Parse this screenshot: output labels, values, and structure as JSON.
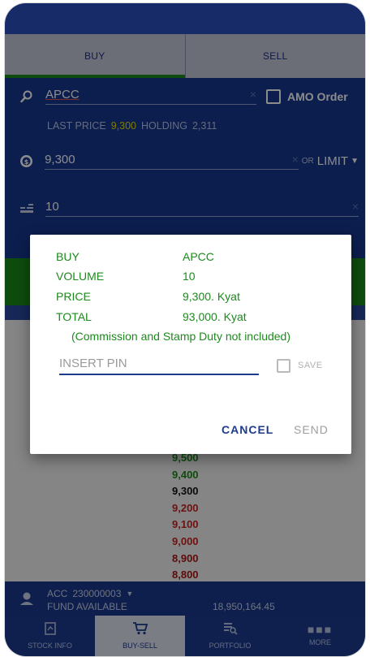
{
  "tabs": {
    "buy": "BUY",
    "sell": "SELL"
  },
  "form": {
    "symbol": "APCC",
    "clear": "×",
    "amo_label": "AMO Order",
    "last_price_label": "LAST PRICE",
    "last_price_value": "9,300",
    "holding_label": "HOLDING",
    "holding_value": "2,311",
    "price_value": "9,300",
    "or_label": "OR",
    "order_type": "LIMIT",
    "quantity_value": "10"
  },
  "price_list": [
    {
      "value": "9,500",
      "color": "#1a8a1a"
    },
    {
      "value": "9,400",
      "color": "#1a8a1a"
    },
    {
      "value": "9,300",
      "color": "#111111"
    },
    {
      "value": "9,200",
      "color": "#cc1f1f"
    },
    {
      "value": "9,100",
      "color": "#cc1f1f"
    },
    {
      "value": "9,000",
      "color": "#cc1f1f"
    },
    {
      "value": "8,900",
      "color": "#aa1414"
    },
    {
      "value": "8,800",
      "color": "#aa1414"
    }
  ],
  "account": {
    "label": "ACC",
    "number": "230000003",
    "fund_label": "FUND AVAILABLE",
    "fund_value": "18,950,164.45"
  },
  "nav": {
    "stock_info": "STOCK INFO",
    "buy_sell": "BUY-SELL",
    "portfolio": "PORTFOLIO",
    "more": "MORE"
  },
  "dialog": {
    "side_label": "BUY",
    "symbol": "APCC",
    "volume_label": "VOLUME",
    "volume_value": "10",
    "price_label": "PRICE",
    "price_value": "9,300. Kyat",
    "total_label": "TOTAL",
    "total_value": "93,000. Kyat",
    "note": "(Commission and Stamp Duty not included)",
    "pin_placeholder": "INSERT PIN",
    "save_label": "SAVE",
    "cancel_label": "CANCEL",
    "send_label": "SEND"
  },
  "colors": {
    "primary": "#17388f",
    "buy_green": "#1a8a1a",
    "last_price_yellow": "#e6e000",
    "dialog_text_green": "#1c8a1c"
  }
}
